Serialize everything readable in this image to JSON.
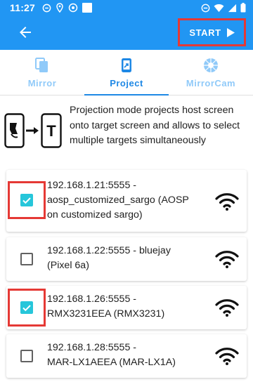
{
  "status_bar": {
    "time": "11:27",
    "left_icons": [
      "notification-icon",
      "location-icon",
      "alarm-icon",
      "square-icon"
    ],
    "right_icons": [
      "dnd-icon",
      "wifi-icon",
      "signal-icon",
      "battery-icon"
    ]
  },
  "app_bar": {
    "back_icon": "arrow-back-icon",
    "start_label": "START",
    "start_icon": "play-icon",
    "bg_color": "#2196f3",
    "highlight_color": "#e53935"
  },
  "tabs": [
    {
      "label": "Mirror",
      "icon": "copy-icon",
      "active": false
    },
    {
      "label": "Project",
      "icon": "phone-cast-icon",
      "active": true
    },
    {
      "label": "MirrorCam",
      "icon": "camera-shutter-icon",
      "active": false
    }
  ],
  "info": {
    "description": "Projection mode projects host screen onto target screen and allows to select multiple targets simultaneously",
    "illustration_letter": "T"
  },
  "devices": [
    {
      "line1": "192.168.1.21:5555 -",
      "line2": "aosp_customized_sargo (AOSP",
      "line3": "on customized sargo)",
      "checked": true,
      "highlighted": true
    },
    {
      "line1": "192.168.1.22:5555 - bluejay",
      "line2": "(Pixel 6a)",
      "line3": "",
      "checked": false,
      "highlighted": false
    },
    {
      "line1": "192.168.1.26:5555 -",
      "line2": "RMX3231EEA (RMX3231)",
      "line3": "",
      "checked": true,
      "highlighted": true
    },
    {
      "line1": "192.168.1.28:5555 -",
      "line2": "MAR-LX1AEEA (MAR-LX1A)",
      "line3": "",
      "checked": false,
      "highlighted": false
    }
  ],
  "colors": {
    "accent": "#1e88e5",
    "check": "#26c6da"
  }
}
